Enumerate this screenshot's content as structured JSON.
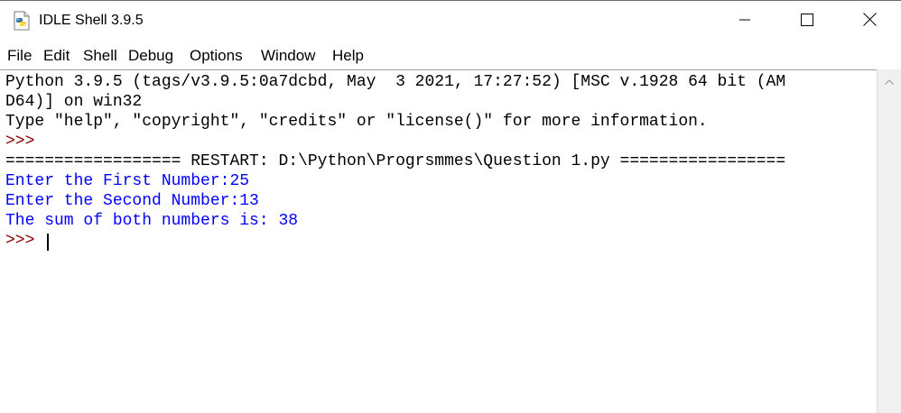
{
  "window": {
    "title": "IDLE Shell 3.9.5",
    "icons": {
      "app": "python-idle-icon",
      "minimize": "minimize-icon",
      "maximize": "maximize-icon",
      "close": "close-icon",
      "scroll_up": "chevron-up-icon"
    }
  },
  "menu": {
    "items": [
      "File",
      "Edit",
      "Shell",
      "Debug",
      "Options",
      "Window",
      "Help"
    ]
  },
  "shell": {
    "lines": [
      {
        "text": "Python 3.9.5 (tags/v3.9.5:0a7dcbd, May  3 2021, 17:27:52) [MSC v.1928 64 bit (AM",
        "style": "normal"
      },
      {
        "text": "D64)] on win32",
        "style": "normal"
      },
      {
        "text": "Type \"help\", \"copyright\", \"credits\" or \"license()\" for more information.",
        "style": "normal"
      },
      {
        "text": ">>>",
        "style": "prompt"
      },
      {
        "text": "================== RESTART: D:\\Python\\Progrsmmes\\Question 1.py =================",
        "style": "restart"
      },
      {
        "text": "Enter the First Number:25",
        "style": "out"
      },
      {
        "text": "Enter the Second Number:13",
        "style": "out"
      },
      {
        "text": "The sum of both numbers is: 38",
        "style": "out"
      },
      {
        "text": ">>> ",
        "style": "prompt"
      }
    ]
  },
  "colors": {
    "output_text": "#0000ff",
    "prompt_text": "#8b0000",
    "normal_text": "#000000"
  }
}
